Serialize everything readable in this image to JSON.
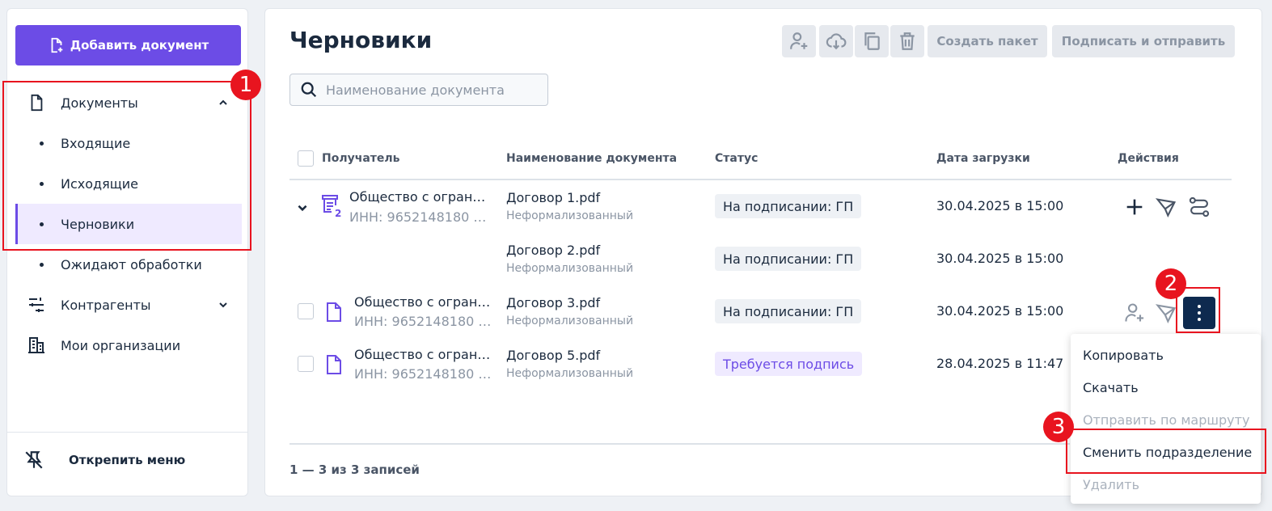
{
  "sidebar": {
    "add_button": "Добавить документ",
    "items": [
      {
        "label": "Документы"
      },
      {
        "label": "Входящие"
      },
      {
        "label": "Исходящие"
      },
      {
        "label": "Черновики"
      },
      {
        "label": "Ожидают обработки"
      },
      {
        "label": "Контрагенты"
      },
      {
        "label": "Мои организации"
      }
    ],
    "unpin": "Открепить меню"
  },
  "main": {
    "title": "Черновики",
    "toolbar": {
      "create_package": "Создать пакет",
      "sign_send": "Подписать и отправить"
    },
    "search_placeholder": "Наименование документа",
    "columns": {
      "recipient": "Получатель",
      "doc_name": "Наименование документа",
      "status": "Статус",
      "upload_date": "Дата загрузки",
      "actions": "Действия"
    },
    "rows": [
      {
        "recipient": "Общество с огран…",
        "inn": "ИНН: 9652148180 …",
        "package_count": "2",
        "doc": "Договор 1.pdf",
        "type": "Неформализованный",
        "status": "На подписании: ГП",
        "date": "30.04.2025 в 15:00"
      },
      {
        "doc": "Договор 2.pdf",
        "type": "Неформализованный",
        "status": "На подписании: ГП",
        "date": "30.04.2025 в 15:00"
      },
      {
        "recipient": "Общество с огран…",
        "inn": "ИНН: 9652148180 …",
        "doc": "Договор 3.pdf",
        "type": "Неформализованный",
        "status": "На подписании: ГП",
        "date": "30.04.2025 в 15:00"
      },
      {
        "recipient": "Общество с огран…",
        "inn": "ИНН: 9652148180 …",
        "doc": "Договор 5.pdf",
        "type": "Неформализованный",
        "status": "Требуется подпись",
        "date": "28.04.2025 в 11:47"
      }
    ],
    "records_text": "1 — 3 из 3 записей"
  },
  "context_menu": {
    "items": [
      "Копировать",
      "Скачать",
      "Отправить по маршруту",
      "Сменить подразделение",
      "Удалить"
    ]
  },
  "markers": [
    "1",
    "2",
    "3"
  ],
  "colors": {
    "accent": "#6c4ce6",
    "dark": "#0e2a4f",
    "annotation": "#e8141f"
  }
}
